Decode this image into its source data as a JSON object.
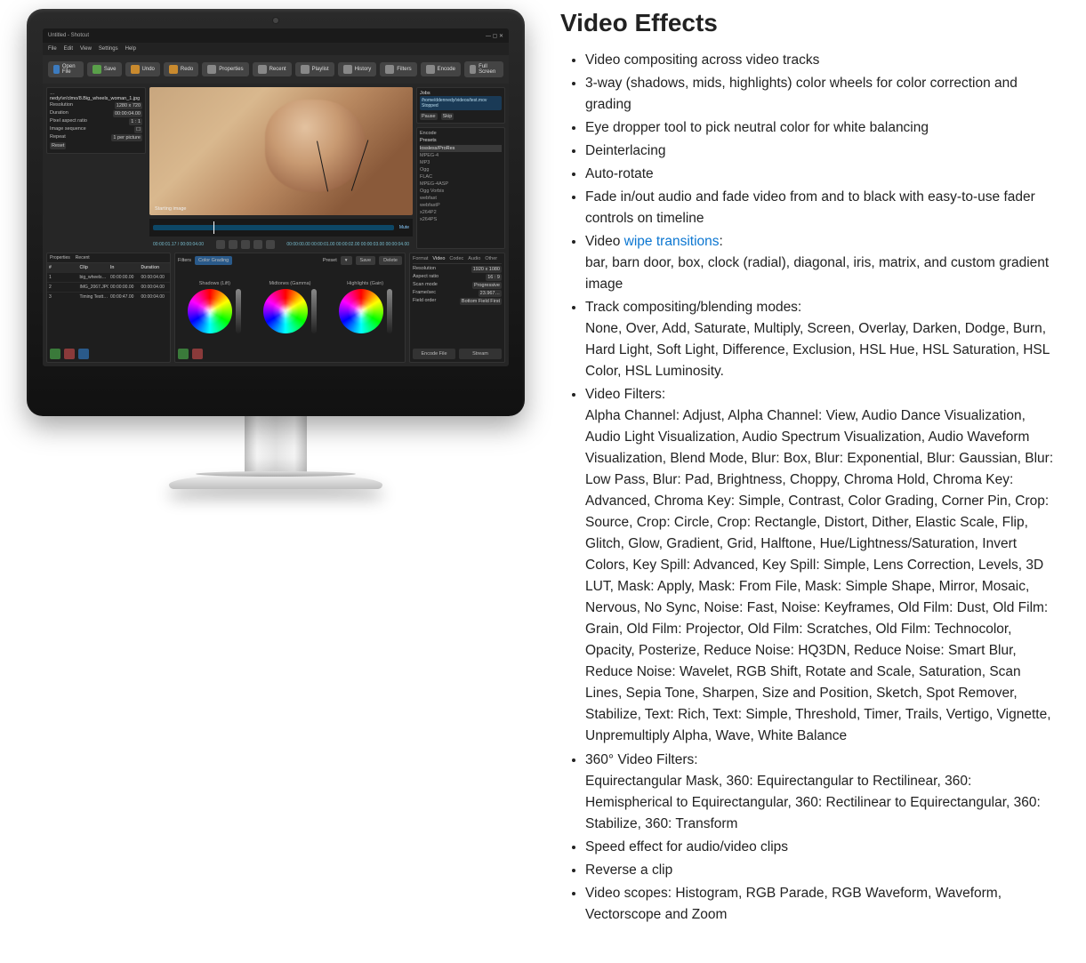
{
  "app_screenshot": {
    "titlebar": "Untitled - Shotcut",
    "menu": [
      "File",
      "Edit",
      "View",
      "Settings",
      "Help"
    ],
    "toolbar": [
      {
        "icon": "open",
        "label": "Open File"
      },
      {
        "icon": "save",
        "label": "Save"
      },
      {
        "icon": "undo",
        "label": "Undo"
      },
      {
        "icon": "redo",
        "label": "Redo"
      },
      {
        "icon": "plain",
        "label": "Properties"
      },
      {
        "icon": "plain",
        "label": "Recent"
      },
      {
        "icon": "plain",
        "label": "Playlist"
      },
      {
        "icon": "plain",
        "label": "History"
      },
      {
        "icon": "plain",
        "label": "Filters"
      },
      {
        "icon": "plain",
        "label": "Encode"
      },
      {
        "icon": "plain",
        "label": "Full Screen"
      }
    ],
    "properties": {
      "pathline": "…nedy/vr/clmo/8.Big_wheels_woman_1.jpg",
      "resolution_label": "Resolution",
      "resolution_value": "1280 x 720",
      "duration_label": "Duration",
      "duration_value": "00:00:04.00",
      "pixel_ar_label": "Pixel aspect ratio",
      "pixel_ar_value": "1 : 1",
      "repeat_label": "Repeat",
      "repeat_value": "1 per picture",
      "img_seq_label": "Image sequence",
      "reset": "Reset"
    },
    "preview_overlay": "Starting image",
    "timecodes": {
      "left": "00:00:01.17  /  00:00:04.00",
      "right": "Mute"
    },
    "ruler_marks": [
      "00:00:00.00",
      "00:00:01.00",
      "00:00:02.00",
      "00:00:03.00",
      "00:00:04.00"
    ],
    "right_panel": {
      "jobs_label": "Jobs",
      "job": "/home/ddennedy/videos/test.mov   Stopped",
      "pause": "Pause",
      "skip": "Skip",
      "encode_label": "Encode",
      "presets_label": "Presets",
      "preset_items": [
        "lossless/ProRes",
        "MPEG-4",
        "MP3",
        "Ogg",
        "FLAC",
        "MPEG-4ASP",
        "Ogg Vorbis",
        "webfast",
        "webfastP",
        "x264P2",
        "x264PS"
      ]
    },
    "playlist": {
      "tabs": [
        "Properties",
        "Recent"
      ],
      "headers": [
        "#",
        "Clip",
        "In",
        "Duration"
      ],
      "rows": [
        [
          "1",
          "big_wheels…",
          "00:00:00.00",
          "00:00:04.00"
        ],
        [
          "2",
          "IMG_2067.JPG",
          "00:00:00.00",
          "00:00:04.00"
        ],
        [
          "3",
          "Timing Testt…",
          "00:00:47.00",
          "00:00:04.00"
        ]
      ]
    },
    "filters": {
      "panel_label": "Filters",
      "filter_name": "Color Grading",
      "preset_label": "Preset",
      "save": "Save",
      "delete": "Delete",
      "wheels": [
        "Shadows (Lift)",
        "Midtones (Gamma)",
        "Highlights (Gain)"
      ]
    },
    "format": {
      "tabs": [
        "Format",
        "Video",
        "Codec",
        "Audio",
        "Other"
      ],
      "rows": [
        [
          "Resolution",
          "1920 x 1080"
        ],
        [
          "Aspect ratio",
          "16 : 9"
        ],
        [
          "Scan mode",
          "Progressive"
        ],
        [
          "Frame/sec",
          "23.967…"
        ],
        [
          "Field order",
          "Bottom Field First"
        ]
      ],
      "encode_btn": "Encode File",
      "stream_btn": "Stream"
    }
  },
  "doc": {
    "heading": "Video Effects",
    "items": [
      {
        "text": "Video compositing across video tracks"
      },
      {
        "text": "3-way (shadows, mids, highlights) color wheels for color correction and grading"
      },
      {
        "text": "Eye dropper tool to pick neutral color for white balancing"
      },
      {
        "text": "Deinterlacing"
      },
      {
        "text": "Auto-rotate"
      },
      {
        "text": "Fade in/out audio and fade video from and to black with easy-to-use fader controls on timeline"
      },
      {
        "prefix": "Video ",
        "link": "wipe transitions",
        "suffix": ":",
        "cont": "bar, barn door, box, clock (radial), diagonal, iris, matrix, and custom gradient image"
      },
      {
        "text": "Track compositing/blending modes:",
        "cont": "None, Over, Add, Saturate, Multiply, Screen, Overlay, Darken, Dodge, Burn, Hard Light, Soft Light, Difference, Exclusion, HSL Hue, HSL Saturation, HSL Color, HSL Luminosity."
      },
      {
        "text": "Video Filters:",
        "cont": "Alpha Channel: Adjust, Alpha Channel: View, Audio Dance Visualization, Audio Light Visualization, Audio Spectrum Visualization, Audio Waveform Visualization, Blend Mode, Blur: Box, Blur: Exponential, Blur: Gaussian, Blur: Low Pass, Blur: Pad, Brightness, Choppy, Chroma Hold, Chroma Key: Advanced, Chroma Key: Simple, Contrast, Color Grading, Corner Pin, Crop: Source, Crop: Circle, Crop: Rectangle, Distort, Dither, Elastic Scale, Flip, Glitch, Glow, Gradient, Grid, Halftone, Hue/Lightness/Saturation, Invert Colors, Key Spill: Advanced, Key Spill: Simple, Lens Correction, Levels, 3D LUT, Mask: Apply, Mask: From File, Mask: Simple Shape, Mirror, Mosaic, Nervous, No Sync, Noise: Fast, Noise: Keyframes, Old Film: Dust, Old Film: Grain, Old Film: Projector, Old Film: Scratches, Old Film: Technocolor, Opacity, Posterize, Reduce Noise: HQ3DN, Reduce Noise: Smart Blur, Reduce Noise: Wavelet, RGB Shift, Rotate and Scale, Saturation, Scan Lines, Sepia Tone, Sharpen, Size and Position, Sketch, Spot Remover, Stabilize, Text: Rich, Text: Simple, Threshold, Timer, Trails, Vertigo, Vignette, Unpremultiply Alpha, Wave, White Balance"
      },
      {
        "text": "360° Video Filters:",
        "cont": "Equirectangular Mask, 360: Equirectangular to Rectilinear, 360: Hemispherical to Equirectangular, 360: Rectilinear to Equirectangular, 360: Stabilize, 360: Transform"
      },
      {
        "text": "Speed effect for audio/video clips"
      },
      {
        "text": "Reverse a clip"
      },
      {
        "text": "Video scopes: Histogram, RGB Parade, RGB Waveform, Waveform, Vectorscope and Zoom"
      }
    ]
  }
}
